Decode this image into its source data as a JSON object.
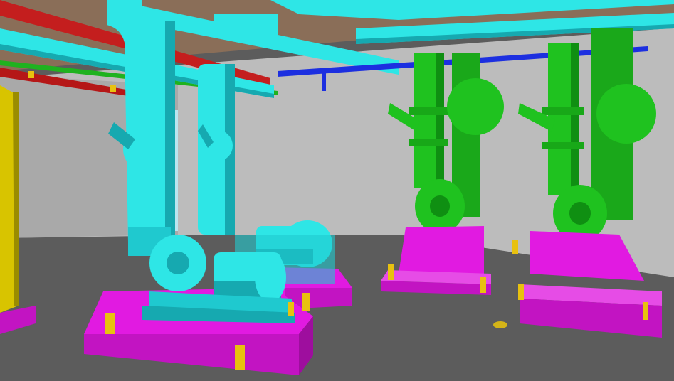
{
  "scene": {
    "description_visible_text": "",
    "colors": {
      "floor": "#5c5c5c",
      "wall": "#bdbdbd",
      "wall_dark": "#8e8e8e",
      "ceiling": "#c9c9c9",
      "cyan": "#2ee6e6",
      "cyan_dark": "#16a9b0",
      "cyan_shadow": "#0e8e96",
      "green": "#1fc21f",
      "green_dark": "#0f8f12",
      "green_shadow": "#0b6e0e",
      "magenta": "#e11ae1",
      "magenta_dark": "#a10ea1",
      "red": "#c41e1e",
      "blue": "#1c2fe0",
      "yellow": "#d8c400",
      "gold": "#e8c10f"
    },
    "elements": {
      "ceiling_pipes": [
        "red-pipe",
        "cyan-pipe-upper",
        "cyan-pipe-lower",
        "green-thin-pipe",
        "blue-pipe"
      ],
      "pumps_cyan": [
        "pump-cyan-front",
        "pump-cyan-back"
      ],
      "pumps_green": [
        "pump-green-left",
        "pump-green-right"
      ],
      "bases": [
        "base-magenta-front-left",
        "base-magenta-back-left",
        "base-magenta-right-1",
        "base-magenta-right-2"
      ]
    }
  }
}
